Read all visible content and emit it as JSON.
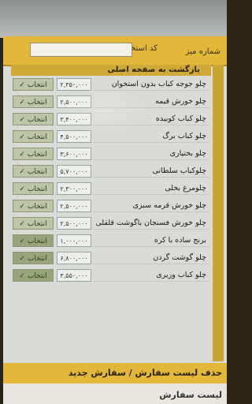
{
  "header": {
    "table_number_label": "شماره میز",
    "employee_code_label": "کد استخدامی",
    "employee_code_value": ""
  },
  "back_button": "بازگشت به صفحه اصلی",
  "select_label": "✓ انتخاب",
  "menu_items": [
    {
      "name": "چلو جوجه کباب بدون استخوان",
      "price": "۲,۳۵۰,۰۰۰"
    },
    {
      "name": "چلو خورش قیمه",
      "price": "۲,۵۰۰,۰۰۰"
    },
    {
      "name": "چلو کباب کوبیده",
      "price": "۳,۴۰۰,۰۰۰"
    },
    {
      "name": "چلو کباب برگ",
      "price": "۴,۵۰۰,۰۰۰"
    },
    {
      "name": "چلو بختیاری",
      "price": "۳,۶۰۰,۰۰۰"
    },
    {
      "name": "چلوکباب سلطانی",
      "price": "۵,۷۰۰,۰۰۰"
    },
    {
      "name": "چلومرغ بخلی",
      "price": "۲,۳۰۰,۰۰۰"
    },
    {
      "name": "چلو خورش قرمه سبزی",
      "price": "۲,۵۰۰,۰۰۰"
    },
    {
      "name": "چلو خورش فسنجان باگوشت قلقلی",
      "price": "۲,۵۰۰,۰۰۰"
    },
    {
      "name": "برنج ساده با کره",
      "price": "۱,۰۰۰,۰۰۰"
    },
    {
      "name": "چلو گوشت گردن",
      "price": "۶,۸۰۰,۰۰۰"
    },
    {
      "name": "چلو کباب وزیری",
      "price": "۳,۵۵۰,۰۰۰"
    }
  ],
  "actions_bar": "حذف لیست سفارش / سفارش جدید",
  "footer_title": "لیست سفارش"
}
